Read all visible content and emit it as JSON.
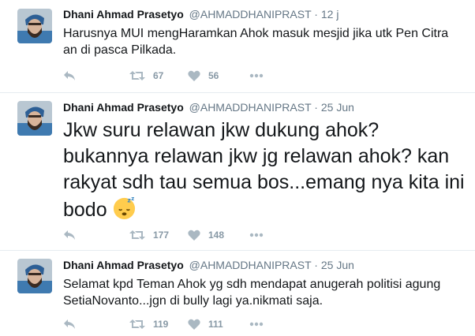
{
  "tweets": [
    {
      "name": "Dhani Ahmad Prasetyo",
      "handle": "@AHMADDHANIPRAST",
      "separator": "·",
      "time": "12 j",
      "text": "Harusnya MUI mengHaramkan Ahok masuk mesjid jika utk Pen Citra an di pasca Pilkada.",
      "retweets": "67",
      "likes": "56"
    },
    {
      "name": "Dhani Ahmad Prasetyo",
      "handle": "@AHMADDHANIPRAST",
      "separator": "·",
      "time": "25 Jun",
      "text": "Jkw suru relawan jkw dukung ahok? bukannya relawan jkw jg relawan ahok? kan rakyat sdh tau semua bos...emang nya kita ini bodo",
      "emoji": "sleeping-face-icon",
      "retweets": "177",
      "likes": "148"
    },
    {
      "name": "Dhani Ahmad Prasetyo",
      "handle": "@AHMADDHANIPRAST",
      "separator": "·",
      "time": "25 Jun",
      "text": "Selamat kpd Teman Ahok yg sdh mendapat anugerah politisi agung SetiaNovanto...jgn di bully lagi ya.nikmati saja.",
      "retweets": "119",
      "likes": "111"
    }
  ],
  "icons": {
    "reply": "reply-icon",
    "retweet": "retweet-icon",
    "like": "heart-icon",
    "more": "more-icon"
  },
  "colors": {
    "name": "#14171a",
    "meta": "#657786",
    "action": "#aab8c2",
    "divider": "#e6ecf0",
    "avatar_bg": "#c9d4dc"
  }
}
